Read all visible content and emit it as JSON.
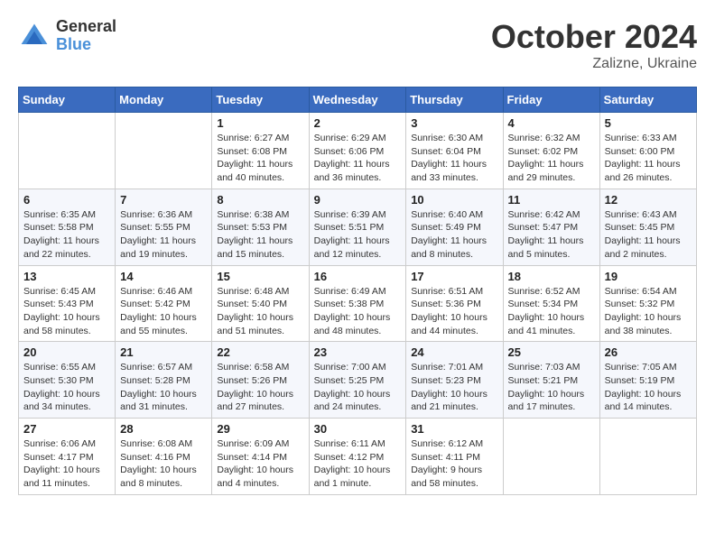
{
  "logo": {
    "general": "General",
    "blue": "Blue"
  },
  "header": {
    "month": "October 2024",
    "location": "Zalizne, Ukraine"
  },
  "days_of_week": [
    "Sunday",
    "Monday",
    "Tuesday",
    "Wednesday",
    "Thursday",
    "Friday",
    "Saturday"
  ],
  "weeks": [
    [
      {
        "day": "",
        "info": ""
      },
      {
        "day": "",
        "info": ""
      },
      {
        "day": "1",
        "info": "Sunrise: 6:27 AM\nSunset: 6:08 PM\nDaylight: 11 hours and 40 minutes."
      },
      {
        "day": "2",
        "info": "Sunrise: 6:29 AM\nSunset: 6:06 PM\nDaylight: 11 hours and 36 minutes."
      },
      {
        "day": "3",
        "info": "Sunrise: 6:30 AM\nSunset: 6:04 PM\nDaylight: 11 hours and 33 minutes."
      },
      {
        "day": "4",
        "info": "Sunrise: 6:32 AM\nSunset: 6:02 PM\nDaylight: 11 hours and 29 minutes."
      },
      {
        "day": "5",
        "info": "Sunrise: 6:33 AM\nSunset: 6:00 PM\nDaylight: 11 hours and 26 minutes."
      }
    ],
    [
      {
        "day": "6",
        "info": "Sunrise: 6:35 AM\nSunset: 5:58 PM\nDaylight: 11 hours and 22 minutes."
      },
      {
        "day": "7",
        "info": "Sunrise: 6:36 AM\nSunset: 5:55 PM\nDaylight: 11 hours and 19 minutes."
      },
      {
        "day": "8",
        "info": "Sunrise: 6:38 AM\nSunset: 5:53 PM\nDaylight: 11 hours and 15 minutes."
      },
      {
        "day": "9",
        "info": "Sunrise: 6:39 AM\nSunset: 5:51 PM\nDaylight: 11 hours and 12 minutes."
      },
      {
        "day": "10",
        "info": "Sunrise: 6:40 AM\nSunset: 5:49 PM\nDaylight: 11 hours and 8 minutes."
      },
      {
        "day": "11",
        "info": "Sunrise: 6:42 AM\nSunset: 5:47 PM\nDaylight: 11 hours and 5 minutes."
      },
      {
        "day": "12",
        "info": "Sunrise: 6:43 AM\nSunset: 5:45 PM\nDaylight: 11 hours and 2 minutes."
      }
    ],
    [
      {
        "day": "13",
        "info": "Sunrise: 6:45 AM\nSunset: 5:43 PM\nDaylight: 10 hours and 58 minutes."
      },
      {
        "day": "14",
        "info": "Sunrise: 6:46 AM\nSunset: 5:42 PM\nDaylight: 10 hours and 55 minutes."
      },
      {
        "day": "15",
        "info": "Sunrise: 6:48 AM\nSunset: 5:40 PM\nDaylight: 10 hours and 51 minutes."
      },
      {
        "day": "16",
        "info": "Sunrise: 6:49 AM\nSunset: 5:38 PM\nDaylight: 10 hours and 48 minutes."
      },
      {
        "day": "17",
        "info": "Sunrise: 6:51 AM\nSunset: 5:36 PM\nDaylight: 10 hours and 44 minutes."
      },
      {
        "day": "18",
        "info": "Sunrise: 6:52 AM\nSunset: 5:34 PM\nDaylight: 10 hours and 41 minutes."
      },
      {
        "day": "19",
        "info": "Sunrise: 6:54 AM\nSunset: 5:32 PM\nDaylight: 10 hours and 38 minutes."
      }
    ],
    [
      {
        "day": "20",
        "info": "Sunrise: 6:55 AM\nSunset: 5:30 PM\nDaylight: 10 hours and 34 minutes."
      },
      {
        "day": "21",
        "info": "Sunrise: 6:57 AM\nSunset: 5:28 PM\nDaylight: 10 hours and 31 minutes."
      },
      {
        "day": "22",
        "info": "Sunrise: 6:58 AM\nSunset: 5:26 PM\nDaylight: 10 hours and 27 minutes."
      },
      {
        "day": "23",
        "info": "Sunrise: 7:00 AM\nSunset: 5:25 PM\nDaylight: 10 hours and 24 minutes."
      },
      {
        "day": "24",
        "info": "Sunrise: 7:01 AM\nSunset: 5:23 PM\nDaylight: 10 hours and 21 minutes."
      },
      {
        "day": "25",
        "info": "Sunrise: 7:03 AM\nSunset: 5:21 PM\nDaylight: 10 hours and 17 minutes."
      },
      {
        "day": "26",
        "info": "Sunrise: 7:05 AM\nSunset: 5:19 PM\nDaylight: 10 hours and 14 minutes."
      }
    ],
    [
      {
        "day": "27",
        "info": "Sunrise: 6:06 AM\nSunset: 4:17 PM\nDaylight: 10 hours and 11 minutes."
      },
      {
        "day": "28",
        "info": "Sunrise: 6:08 AM\nSunset: 4:16 PM\nDaylight: 10 hours and 8 minutes."
      },
      {
        "day": "29",
        "info": "Sunrise: 6:09 AM\nSunset: 4:14 PM\nDaylight: 10 hours and 4 minutes."
      },
      {
        "day": "30",
        "info": "Sunrise: 6:11 AM\nSunset: 4:12 PM\nDaylight: 10 hours and 1 minute."
      },
      {
        "day": "31",
        "info": "Sunrise: 6:12 AM\nSunset: 4:11 PM\nDaylight: 9 hours and 58 minutes."
      },
      {
        "day": "",
        "info": ""
      },
      {
        "day": "",
        "info": ""
      }
    ]
  ]
}
